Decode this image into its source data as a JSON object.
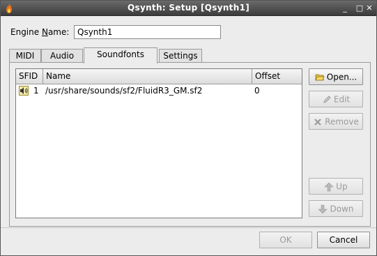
{
  "window": {
    "title": "Qsynth: Setup [Qsynth1]",
    "controls": {
      "minimize": "_",
      "maximize": "□",
      "close": "✕"
    }
  },
  "engine": {
    "label": "Engine Name:",
    "label_mnemonic": "N",
    "value": "Qsynth1"
  },
  "tabs": [
    {
      "label": "MIDI",
      "active": false
    },
    {
      "label": "Audio",
      "active": false
    },
    {
      "label": "Soundfonts",
      "active": true
    },
    {
      "label": "Settings",
      "active": false
    }
  ],
  "soundfonts": {
    "columns": [
      "SFID",
      "Name",
      "Offset"
    ],
    "rows": [
      {
        "sfid": "1",
        "name": "/usr/share/sounds/sf2/FluidR3_GM.sf2",
        "offset": "0"
      }
    ]
  },
  "side_buttons": {
    "open": "Open...",
    "edit": "Edit",
    "remove": "Remove",
    "up": "Up",
    "down": "Down"
  },
  "dialog_buttons": {
    "ok": "OK",
    "cancel": "Cancel"
  },
  "icons": {
    "app": "flame-icon",
    "soundfont": "speaker-icon",
    "open": "folder-icon",
    "edit": "pencil-icon",
    "remove": "x-icon",
    "up": "arrow-up-icon",
    "down": "arrow-down-icon"
  },
  "colors": {
    "titlebar": "#4a4a4a",
    "panel": "#ececec",
    "disabled_text": "#9a9a9a"
  }
}
